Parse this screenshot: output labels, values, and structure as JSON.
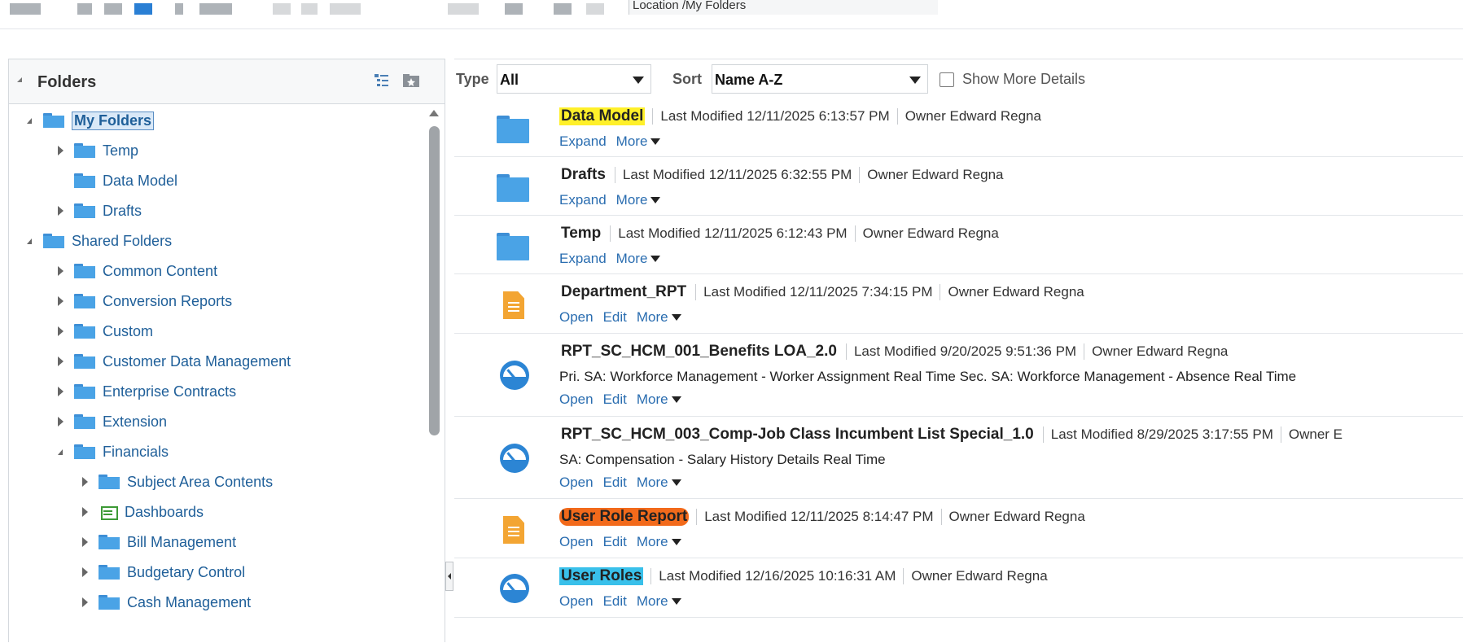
{
  "toolbar": {
    "location_text": "Location /My Folders"
  },
  "folders_panel": {
    "title": "Folders",
    "tree": [
      {
        "label": "My Folders",
        "expanded": true,
        "selected": true
      },
      {
        "label": "Temp",
        "expanded": false
      },
      {
        "label": "Data Model"
      },
      {
        "label": "Drafts",
        "expanded": false
      },
      {
        "label": "Shared Folders",
        "expanded": true
      },
      {
        "label": "Common Content",
        "expanded": false
      },
      {
        "label": "Conversion Reports",
        "expanded": false
      },
      {
        "label": "Custom",
        "expanded": false
      },
      {
        "label": "Customer Data Management",
        "expanded": false
      },
      {
        "label": "Enterprise Contracts",
        "expanded": false
      },
      {
        "label": "Extension",
        "expanded": false
      },
      {
        "label": "Financials",
        "expanded": true
      },
      {
        "label": "Subject Area Contents",
        "expanded": false
      },
      {
        "label": "Dashboards",
        "expanded": false
      },
      {
        "label": "Bill Management",
        "expanded": false
      },
      {
        "label": "Budgetary Control",
        "expanded": false
      },
      {
        "label": "Cash Management",
        "expanded": false
      }
    ]
  },
  "filters": {
    "type_label": "Type",
    "type_value": "All",
    "sort_label": "Sort",
    "sort_value": "Name A-Z",
    "show_more_label": "Show More Details",
    "show_more_checked": false
  },
  "items": [
    {
      "name": "Data Model",
      "icon": "folder-icon",
      "modified": "Last Modified 12/11/2025 6:13:57 PM",
      "owner": "Owner Edward Regna",
      "actions": [
        "Expand",
        "More"
      ],
      "highlight": "yellow"
    },
    {
      "name": "Drafts",
      "icon": "folder-icon",
      "modified": "Last Modified 12/11/2025 6:32:55 PM",
      "owner": "Owner Edward Regna",
      "actions": [
        "Expand",
        "More"
      ]
    },
    {
      "name": "Temp",
      "icon": "folder-icon",
      "modified": "Last Modified 12/11/2025 6:12:43 PM",
      "owner": "Owner Edward Regna",
      "actions": [
        "Expand",
        "More"
      ]
    },
    {
      "name": "Department_RPT",
      "icon": "report-icon",
      "modified": "Last Modified 12/11/2025 7:34:15 PM",
      "owner": "Owner Edward Regna",
      "actions": [
        "Open",
        "Edit",
        "More"
      ]
    },
    {
      "name": "RPT_SC_HCM_001_Benefits LOA_2.0",
      "icon": "analysis-icon",
      "modified": "Last Modified 9/20/2025 9:51:36 PM",
      "owner": "Owner Edward Regna",
      "description": "Pri. SA: Workforce Management - Worker Assignment Real Time Sec. SA: Workforce Management - Absence Real Time",
      "actions": [
        "Open",
        "Edit",
        "More"
      ]
    },
    {
      "name": "RPT_SC_HCM_003_Comp-Job Class Incumbent List Special_1.0",
      "icon": "analysis-icon",
      "modified": "Last Modified 8/29/2025 3:17:55 PM",
      "owner": "Owner E",
      "description": "SA: Compensation - Salary History Details Real Time",
      "actions": [
        "Open",
        "Edit",
        "More"
      ]
    },
    {
      "name": "User Role Report",
      "icon": "report-icon",
      "modified": "Last Modified 12/11/2025 8:14:47 PM",
      "owner": "Owner Edward Regna",
      "actions": [
        "Open",
        "Edit",
        "More"
      ],
      "highlight": "orange"
    },
    {
      "name": "User Roles",
      "icon": "analysis-icon",
      "modified": "Last Modified 12/16/2025 10:16:31 AM",
      "owner": "Owner Edward Regna",
      "actions": [
        "Open",
        "Edit",
        "More"
      ],
      "highlight": "cyan"
    }
  ]
}
